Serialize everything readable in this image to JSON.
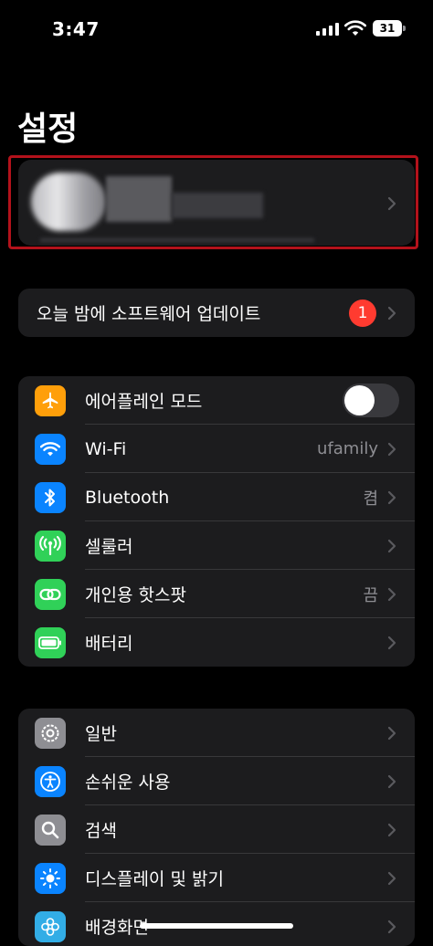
{
  "status_bar": {
    "time": "3:47",
    "battery_level": "31"
  },
  "page_title": "설정",
  "update_row": {
    "label": "오늘 밤에 소프트웨어 업데이트",
    "badge": "1"
  },
  "connectivity": [
    {
      "label": "에어플레인 모드",
      "icon": "airplane-icon",
      "color": "#ff9f0a",
      "toggle": false
    },
    {
      "label": "Wi-Fi",
      "icon": "wifi-icon",
      "color": "#0a84ff",
      "value": "ufamily"
    },
    {
      "label": "Bluetooth",
      "icon": "bluetooth-icon",
      "color": "#0a84ff",
      "value": "켬"
    },
    {
      "label": "셀룰러",
      "icon": "cellular-icon",
      "color": "#30d158"
    },
    {
      "label": "개인용 핫스팟",
      "icon": "hotspot-icon",
      "color": "#30d158",
      "value": "끔"
    },
    {
      "label": "배터리",
      "icon": "battery-icon",
      "color": "#30d158"
    }
  ],
  "general": [
    {
      "label": "일반",
      "icon": "gear-icon",
      "color": "#8e8e93"
    },
    {
      "label": "손쉬운 사용",
      "icon": "accessibility-icon",
      "color": "#0a84ff"
    },
    {
      "label": "검색",
      "icon": "search-icon",
      "color": "#8e8e93"
    },
    {
      "label": "디스플레이 및 밝기",
      "icon": "brightness-icon",
      "color": "#0a84ff"
    },
    {
      "label": "배경화면",
      "icon": "wallpaper-icon",
      "color": "#32ade6"
    }
  ]
}
